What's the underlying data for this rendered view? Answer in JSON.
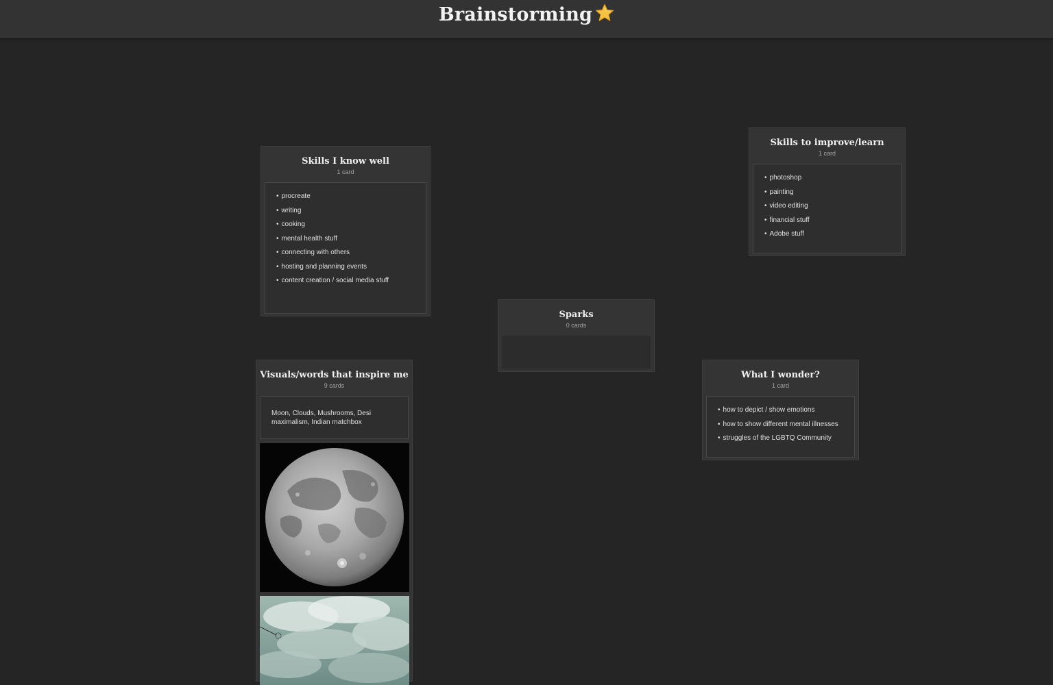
{
  "board": {
    "title": "Brainstorming",
    "title_icon": "star-icon"
  },
  "columns": {
    "skills_known": {
      "title": "Skills I know well",
      "count": "1 card",
      "items": [
        "procreate",
        "writing",
        "cooking",
        "mental health stuff",
        "connecting with others",
        "hosting and planning events",
        "content creation / social media stuff"
      ]
    },
    "skills_improve": {
      "title": "Skills to improve/learn",
      "count": "1 card",
      "items": [
        "photoshop",
        "painting",
        "video editing",
        "financial stuff",
        "Adobe stuff"
      ]
    },
    "sparks": {
      "title": "Sparks",
      "count": "0 cards"
    },
    "inspire": {
      "title": "Visuals/words that inspire me",
      "count": "9 cards",
      "text_card": "Moon, Clouds, Mushrooms, Desi maximalism, Indian matchbox",
      "images": [
        "moon-image",
        "clouds-image"
      ]
    },
    "wonder": {
      "title": "What I wonder?",
      "count": "1 card",
      "items": [
        "how to depict / show emotions",
        "how to show different mental illnesses",
        "struggles of the LGBTQ Community"
      ]
    }
  },
  "colors": {
    "background": "#252525",
    "header": "#333333",
    "column": "#343434",
    "card": "#2e2e2e",
    "star": "#f6c343"
  }
}
